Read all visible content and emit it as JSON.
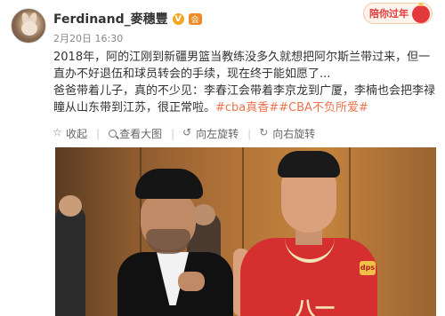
{
  "header": {
    "username": "Ferdinand_麥穗豐",
    "badge_v": "V",
    "badge_member": "会",
    "meta": "2月20日 16:30",
    "festival": "陪你过年"
  },
  "post": {
    "para1": "2018年，阿的江刚到新疆男篮当教练没多久就想把阿尔斯兰带过来，但一直办不好退伍和球员转会的手续，现在终于能如愿了...",
    "para2": "爸爸带着儿子，真的不少见：李春江会带着李京龙到广厦，李楠也会把李禄瞳从山东带到江苏，很正常啦。",
    "hashtag1": "#cba真香#",
    "hashtag2": "#CBA不负所爱#"
  },
  "actions": {
    "collapse": "收起",
    "view_large": "查看大图",
    "rotate_left": "向左旋转",
    "rotate_right": "向右旋转"
  },
  "photo": {
    "jersey_number": "八一",
    "logo": "dps"
  },
  "colors": {
    "hashtag": "#eb7350",
    "jersey": "#d62f2f",
    "festival": "#e4393c"
  }
}
